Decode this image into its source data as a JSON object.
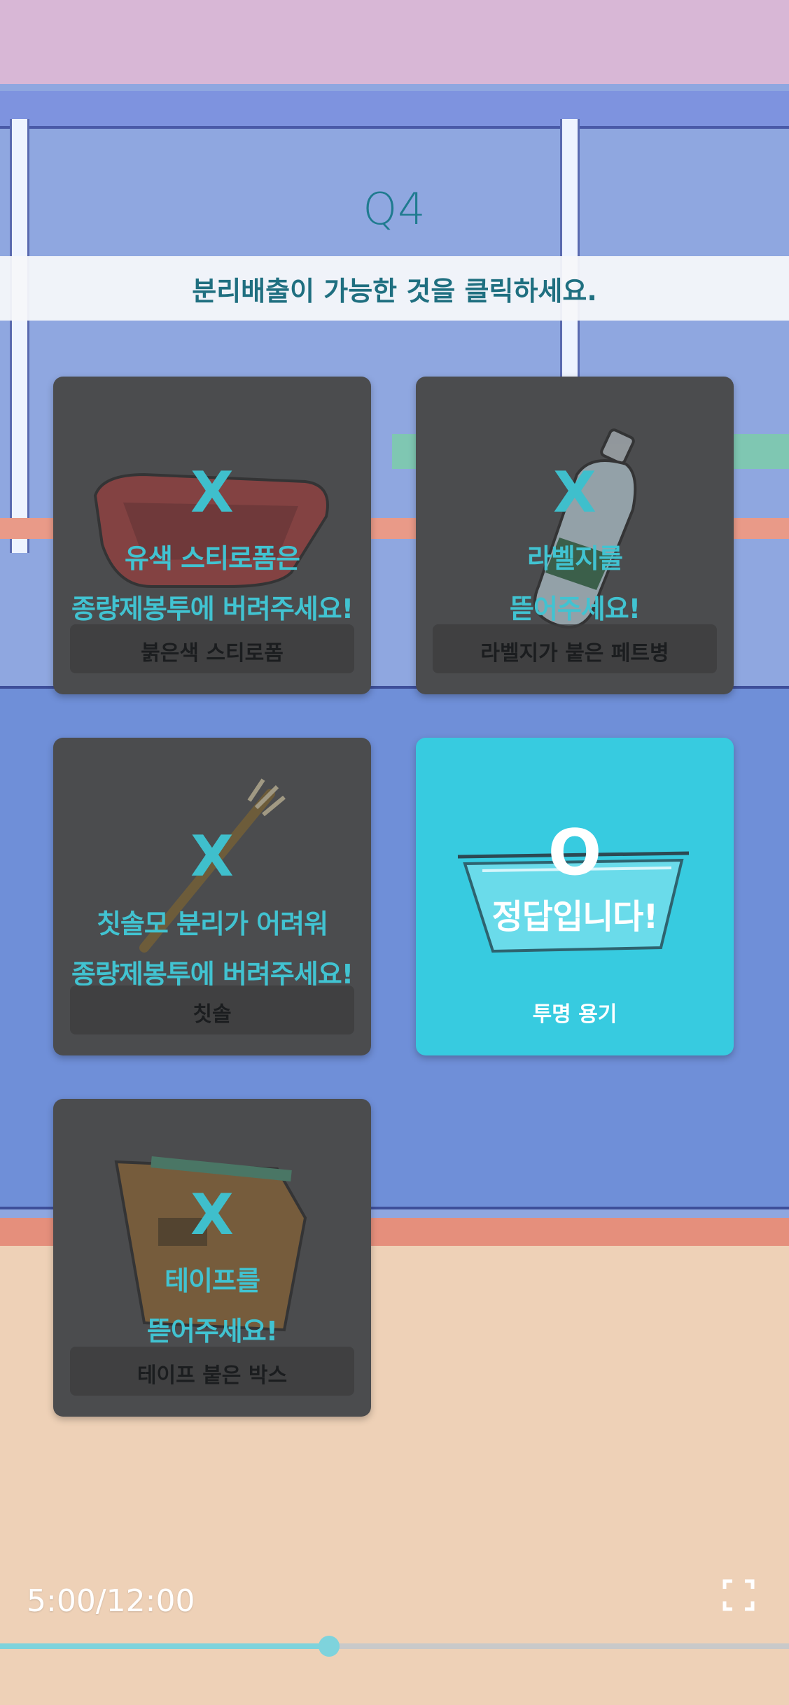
{
  "question": {
    "number": "Q4",
    "instruction": "분리배출이 가능한 것을 클릭하세요."
  },
  "cards": [
    {
      "mark": "X",
      "feedback_line1": "유색 스티로폼은",
      "feedback_line2": "종량제봉투에 버려주세요!",
      "label": "붉은색 스티로폼",
      "icon": "red-styrofoam-tray-icon",
      "correct": false
    },
    {
      "mark": "X",
      "feedback_line1": "라벨지를",
      "feedback_line2": "뜯어주세요!",
      "label": "라벨지가 붙은 페트병",
      "icon": "labeled-pet-bottle-icon",
      "correct": false
    },
    {
      "mark": "X",
      "feedback_line1": "칫솔모 분리가 어려워",
      "feedback_line2": "종량제봉투에 버려주세요!",
      "label": "칫솔",
      "icon": "toothbrush-icon",
      "correct": false
    },
    {
      "mark": "O",
      "feedback_line1": "정답입니다!",
      "feedback_line2": "",
      "label": "투명 용기",
      "icon": "clear-plastic-container-icon",
      "correct": true
    },
    {
      "mark": "X",
      "feedback_line1": "테이프를",
      "feedback_line2": "뜯어주세요!",
      "label": "테이프 붙은 박스",
      "icon": "taped-box-icon",
      "correct": false
    }
  ],
  "player": {
    "time_display": "5:00/12:00",
    "progress_fraction": 0.4167,
    "fullscreen_icon": "fullscreen-icon"
  },
  "colors": {
    "accent": "#37cbe0",
    "card_dark": "#4b4c4e",
    "feedback_text": "#41c3d1",
    "title": "#1f7b8f"
  }
}
